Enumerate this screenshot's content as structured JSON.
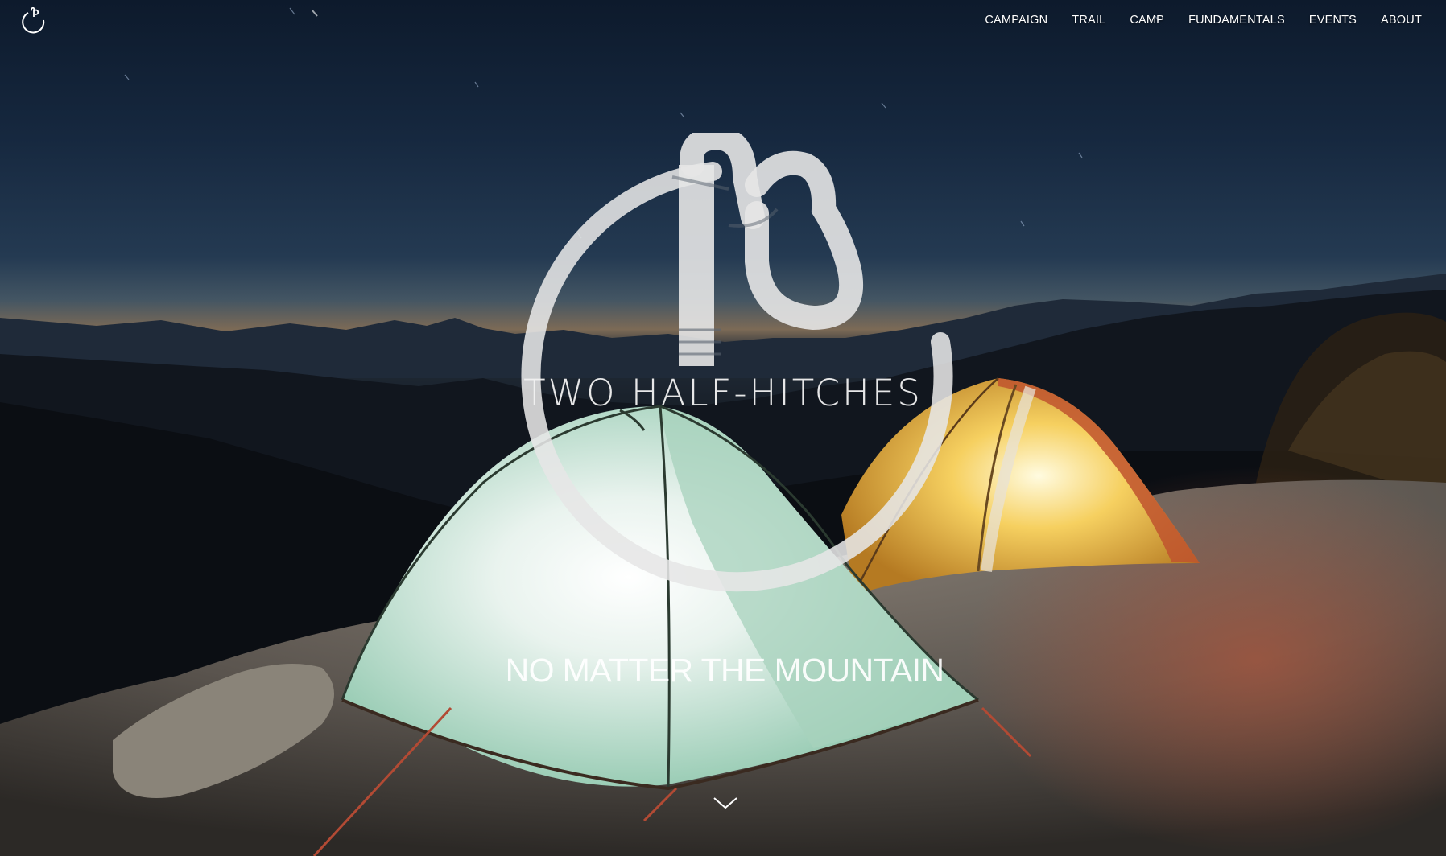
{
  "brand": {
    "nav_logo_icon": "two-half-hitches-knot-icon",
    "name": "TWO HALF-HITCHES",
    "logo_icon": "two-half-hitches-knot-logo"
  },
  "nav": {
    "items": [
      {
        "label": "CAMPAIGN"
      },
      {
        "label": "TRAIL"
      },
      {
        "label": "CAMP"
      },
      {
        "label": "FUNDAMENTALS"
      },
      {
        "label": "EVENTS"
      },
      {
        "label": "ABOUT"
      }
    ]
  },
  "hero": {
    "tagline": "NO MATTER THE MOUNTAIN",
    "scroll_icon": "chevron-down-icon",
    "background_image": "night-camp-two-lit-tents"
  },
  "colors": {
    "nav_text": "#ffffff",
    "logo_stroke": "#e6e6e6",
    "sky_top": "#0d1a2c",
    "horizon_glow": "#7c6a56",
    "tent_green": "#a8d6c0",
    "tent_yellow": "#f5c84a"
  }
}
